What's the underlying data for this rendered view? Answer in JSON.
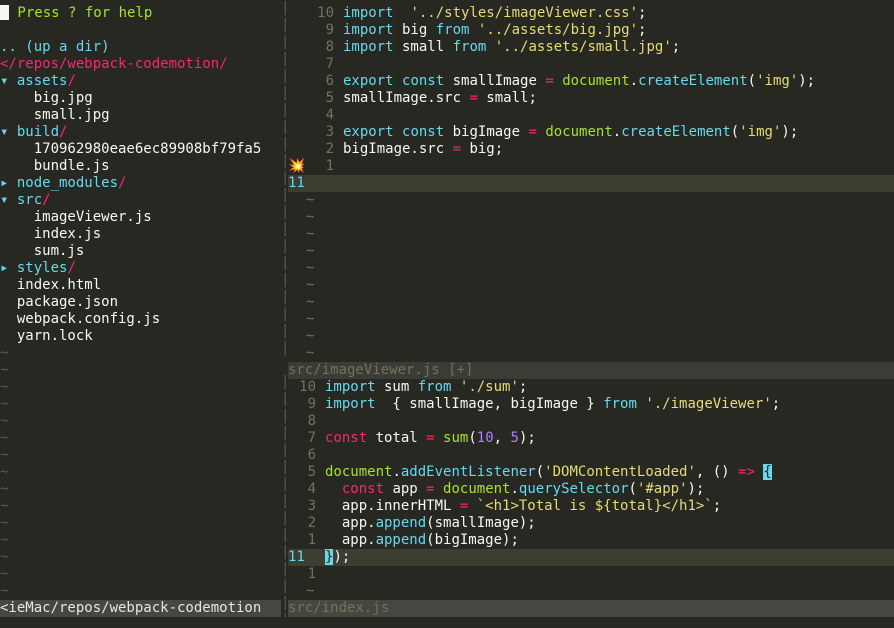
{
  "tree": {
    "help_cursor": "\"",
    "help_text": " Press ? for help",
    "up_dir": ".. (up a dir)",
    "root": "</repos/webpack-codemotion/",
    "entries": [
      {
        "arrow": "▾ ",
        "name": "assets",
        "slash": "/"
      },
      {
        "indent": "    ",
        "name": "big.jpg"
      },
      {
        "indent": "    ",
        "name": "small.jpg"
      },
      {
        "arrow": "▾ ",
        "name": "build",
        "slash": "/"
      },
      {
        "indent": "    ",
        "name": "170962980eae6ec89908bf79fa5"
      },
      {
        "indent": "    ",
        "name": "bundle.js"
      },
      {
        "arrow": "▸ ",
        "name": "node_modules",
        "slash": "/"
      },
      {
        "arrow": "▾ ",
        "name": "src",
        "slash": "/"
      },
      {
        "indent": "    ",
        "name": "imageViewer.js"
      },
      {
        "indent": "    ",
        "name": "index.js"
      },
      {
        "indent": "    ",
        "name": "sum.js"
      },
      {
        "arrow": "▸ ",
        "name": "styles",
        "slash": "/"
      },
      {
        "indent": "  ",
        "name": "index.html"
      },
      {
        "indent": "  ",
        "name": "package.json"
      },
      {
        "indent": "  ",
        "name": "webpack.config.js"
      },
      {
        "indent": "  ",
        "name": "yarn.lock"
      }
    ],
    "tilde": "~",
    "status": "<ieMac/repos/webpack-codemotion"
  },
  "top_window": {
    "lines": [
      {
        "num": "10",
        "tokens": [
          [
            "k",
            "import"
          ],
          [
            "",
            "  "
          ],
          [
            "s",
            "'../styles/imageViewer.css'"
          ],
          [
            "",
            ";"
          ]
        ]
      },
      {
        "num": "9",
        "tokens": [
          [
            "k",
            "import"
          ],
          [
            "",
            " big "
          ],
          [
            "k",
            "from"
          ],
          [
            "",
            " "
          ],
          [
            "s",
            "'../assets/big.jpg'"
          ],
          [
            "",
            ";"
          ]
        ]
      },
      {
        "num": "8",
        "tokens": [
          [
            "k",
            "import"
          ],
          [
            "",
            " small "
          ],
          [
            "k",
            "from"
          ],
          [
            "",
            " "
          ],
          [
            "s",
            "'../assets/small.jpg'"
          ],
          [
            "",
            ";"
          ]
        ]
      },
      {
        "num": "7",
        "tokens": []
      },
      {
        "num": "6",
        "tokens": [
          [
            "k",
            "export"
          ],
          [
            "",
            " "
          ],
          [
            "k",
            "const"
          ],
          [
            "",
            " smallImage "
          ],
          [
            "op",
            "="
          ],
          [
            "",
            " "
          ],
          [
            "fn",
            "document"
          ],
          [
            "",
            "."
          ],
          [
            "pr",
            "createElement"
          ],
          [
            "",
            "("
          ],
          [
            "s",
            "'img'"
          ],
          [
            "",
            ");"
          ]
        ]
      },
      {
        "num": "5",
        "tokens": [
          [
            "",
            "smallImage.src "
          ],
          [
            "op",
            "="
          ],
          [
            "",
            " small;"
          ]
        ]
      },
      {
        "num": "4",
        "tokens": []
      },
      {
        "num": "3",
        "tokens": [
          [
            "k",
            "export"
          ],
          [
            "",
            " "
          ],
          [
            "k",
            "const"
          ],
          [
            "",
            " bigImage "
          ],
          [
            "op",
            "="
          ],
          [
            "",
            " "
          ],
          [
            "fn",
            "document"
          ],
          [
            "",
            "."
          ],
          [
            "pr",
            "createElement"
          ],
          [
            "",
            "("
          ],
          [
            "s",
            "'img'"
          ],
          [
            "",
            ");"
          ]
        ]
      },
      {
        "num": "2",
        "tokens": [
          [
            "",
            "bigImage.src "
          ],
          [
            "op",
            "="
          ],
          [
            "",
            " big;"
          ]
        ]
      },
      {
        "num": "1",
        "sign": "💥",
        "tokens": []
      },
      {
        "num": "11",
        "current": true,
        "tokens": []
      }
    ],
    "status": "src/imageViewer.js [+]"
  },
  "bottom_window": {
    "lines": [
      {
        "num": "10",
        "tokens": [
          [
            "k",
            "import"
          ],
          [
            "",
            " sum "
          ],
          [
            "k",
            "from"
          ],
          [
            "",
            " "
          ],
          [
            "s",
            "'./sum'"
          ],
          [
            "",
            ";"
          ]
        ]
      },
      {
        "num": "9",
        "tokens": [
          [
            "k",
            "import"
          ],
          [
            "",
            "  { smallImage, bigImage } "
          ],
          [
            "k",
            "from"
          ],
          [
            "",
            " "
          ],
          [
            "s",
            "'./imageViewer'"
          ],
          [
            "",
            ";"
          ]
        ]
      },
      {
        "num": "8",
        "tokens": []
      },
      {
        "num": "7",
        "tokens": [
          [
            "kp",
            "const"
          ],
          [
            "",
            " total "
          ],
          [
            "op",
            "="
          ],
          [
            "",
            " "
          ],
          [
            "fn",
            "sum"
          ],
          [
            "",
            "("
          ],
          [
            "n",
            "10"
          ],
          [
            "",
            ", "
          ],
          [
            "n",
            "5"
          ],
          [
            "",
            ");"
          ]
        ]
      },
      {
        "num": "6",
        "tokens": []
      },
      {
        "num": "5",
        "tokens": [
          [
            "fn",
            "document"
          ],
          [
            "",
            "."
          ],
          [
            "pr",
            "addEventListener"
          ],
          [
            "",
            "("
          ],
          [
            "s",
            "'DOMContentLoaded'"
          ],
          [
            "",
            ", () "
          ],
          [
            "op",
            "=>"
          ],
          [
            "",
            " "
          ],
          [
            "br",
            "{"
          ]
        ]
      },
      {
        "num": "4",
        "tokens": [
          [
            "",
            "  "
          ],
          [
            "kp",
            "const"
          ],
          [
            "",
            " app "
          ],
          [
            "op",
            "="
          ],
          [
            "",
            " "
          ],
          [
            "fn",
            "document"
          ],
          [
            "",
            "."
          ],
          [
            "pr",
            "querySelector"
          ],
          [
            "",
            "("
          ],
          [
            "s",
            "'#app'"
          ],
          [
            "",
            ");"
          ]
        ]
      },
      {
        "num": "3",
        "tokens": [
          [
            "",
            "  app.innerHTML "
          ],
          [
            "op",
            "="
          ],
          [
            "",
            " "
          ],
          [
            "s",
            "`<h1>Total is ${total}</h1>`"
          ],
          [
            "",
            ";"
          ]
        ]
      },
      {
        "num": "2",
        "tokens": [
          [
            "",
            "  app."
          ],
          [
            "pr",
            "append"
          ],
          [
            "",
            "(smallImage);"
          ]
        ]
      },
      {
        "num": "1",
        "tokens": [
          [
            "",
            "  app."
          ],
          [
            "pr",
            "append"
          ],
          [
            "",
            "(bigImage);"
          ]
        ]
      },
      {
        "num": "11",
        "current": true,
        "tokens": [
          [
            "br",
            "}"
          ],
          [
            "",
            ");"
          ]
        ]
      },
      {
        "num": "1",
        "tokens": []
      }
    ],
    "status": "src/index.js"
  },
  "split_char": "|",
  "tilde": "~"
}
